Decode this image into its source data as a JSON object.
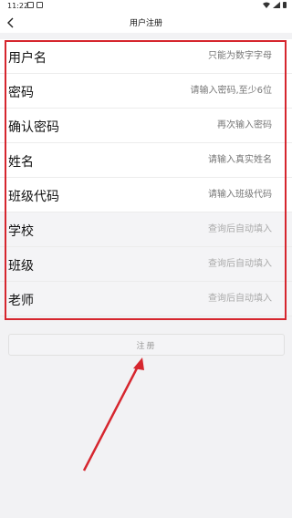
{
  "status_bar": {
    "time": "11:22"
  },
  "nav": {
    "title": "用户注册",
    "back_icon": "chevron-left-icon"
  },
  "form": {
    "fields": [
      {
        "label": "用户名",
        "placeholder": "只能为数字字母",
        "editable": true
      },
      {
        "label": "密码",
        "placeholder": "请输入密码,至少6位",
        "editable": true
      },
      {
        "label": "确认密码",
        "placeholder": "再次输入密码",
        "editable": true
      },
      {
        "label": "姓名",
        "placeholder": "请输入真实姓名",
        "editable": true
      },
      {
        "label": "班级代码",
        "placeholder": "请输入班级代码",
        "editable": true
      },
      {
        "label": "学校",
        "placeholder": "查询后自动填入",
        "editable": false
      },
      {
        "label": "班级",
        "placeholder": "查询后自动填入",
        "editable": false
      },
      {
        "label": "老师",
        "placeholder": "查询后自动填入",
        "editable": false
      }
    ]
  },
  "register_button": {
    "label": "注册"
  },
  "annotation": {
    "color": "#d6262e"
  }
}
